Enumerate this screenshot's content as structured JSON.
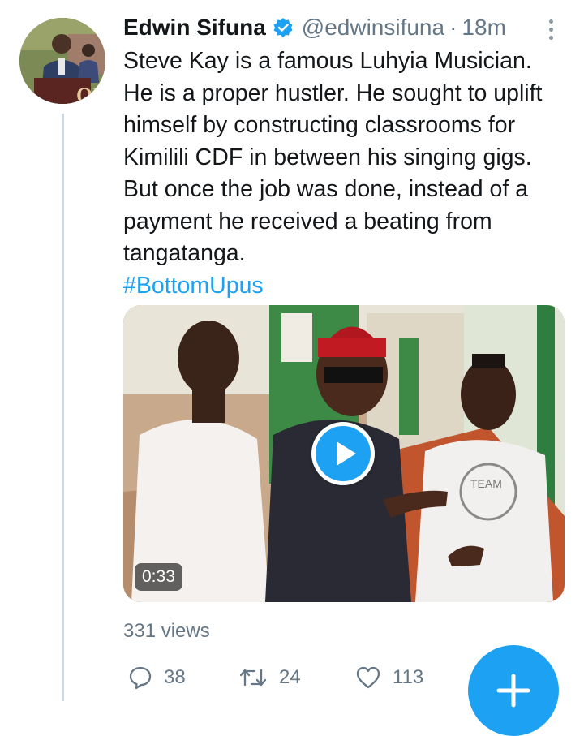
{
  "tweet": {
    "author_name": "Edwin Sifuna",
    "handle": "@edwinsifuna",
    "separator": "·",
    "time": "18m",
    "text": "Steve Kay is a famous Luhyia Musician.\nHe is a proper hustler. He sought to uplift\nhimself by constructing classrooms for\nKimilili CDF in between his singing gigs.\nBut once the job was done, instead of a\npayment he received a beating from\ntangatanga.",
    "hashtag": "#BottomUpus"
  },
  "avatar": {
    "logo_text": "OD"
  },
  "video": {
    "duration": "0:33",
    "shirt_text": "TEAM"
  },
  "stats": {
    "views": "331 views",
    "replies": "38",
    "retweets": "24",
    "likes": "113"
  },
  "icons": {
    "verified": "verified-badge-icon",
    "more": "more-vertical-icon",
    "play": "play-icon",
    "reply": "reply-icon",
    "retweet": "retweet-icon",
    "like": "heart-icon",
    "compose": "plus-icon"
  },
  "colors": {
    "accent": "#1da1f2",
    "text": "#14171a",
    "muted": "#657786",
    "thread_line": "#cfd9de"
  }
}
